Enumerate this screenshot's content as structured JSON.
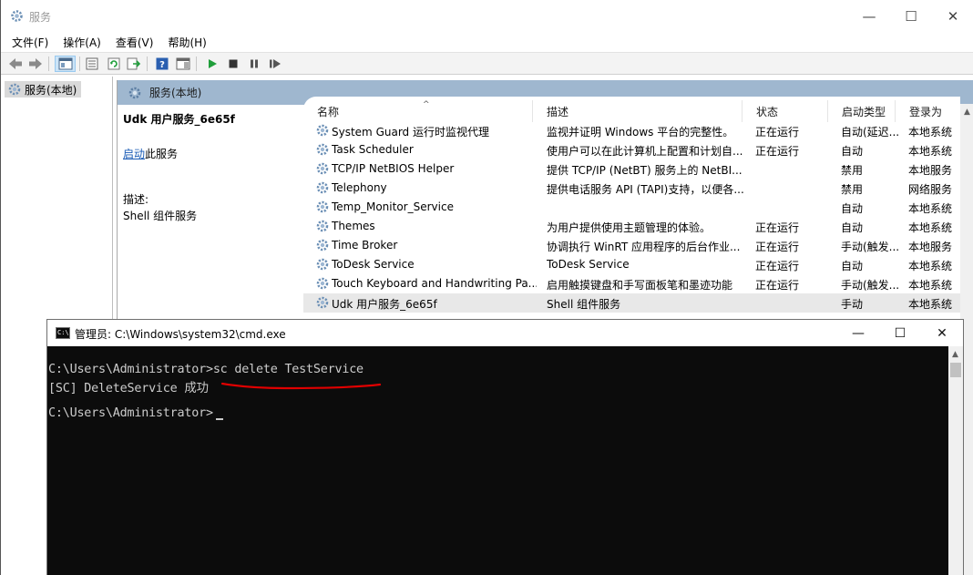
{
  "services_window": {
    "title": "服务",
    "caption": {
      "minimize": "—",
      "maximize": "☐",
      "close": "✕"
    },
    "menu": [
      "文件(F)",
      "操作(A)",
      "查看(V)",
      "帮助(H)"
    ],
    "tree_item": "服务(本地)",
    "panel_header": "服务(本地)",
    "detail": {
      "name": "Udk 用户服务_6e65f",
      "start_link": "启动",
      "start_suffix": "此服务",
      "desc_label": "描述:",
      "desc": "Shell 组件服务"
    },
    "columns": {
      "name": "名称",
      "desc": "描述",
      "status": "状态",
      "type": "启动类型",
      "logon": "登录为"
    },
    "rows": [
      {
        "name": "System Guard 运行时监视代理",
        "desc": "监视并证明 Windows 平台的完整性。",
        "status": "正在运行",
        "type": "自动(延迟...",
        "logon": "本地系统"
      },
      {
        "name": "Task Scheduler",
        "desc": "使用户可以在此计算机上配置和计划自...",
        "status": "正在运行",
        "type": "自动",
        "logon": "本地系统"
      },
      {
        "name": "TCP/IP NetBIOS Helper",
        "desc": "提供 TCP/IP (NetBT) 服务上的 NetBI...",
        "status": "",
        "type": "禁用",
        "logon": "本地服务"
      },
      {
        "name": "Telephony",
        "desc": "提供电话服务 API (TAPI)支持，以便各...",
        "status": "",
        "type": "禁用",
        "logon": "网络服务"
      },
      {
        "name": "Temp_Monitor_Service",
        "desc": "",
        "status": "",
        "type": "自动",
        "logon": "本地系统"
      },
      {
        "name": "Themes",
        "desc": "为用户提供使用主题管理的体验。",
        "status": "正在运行",
        "type": "自动",
        "logon": "本地系统"
      },
      {
        "name": "Time Broker",
        "desc": "协调执行 WinRT 应用程序的后台作业...",
        "status": "正在运行",
        "type": "手动(触发...",
        "logon": "本地服务"
      },
      {
        "name": "ToDesk Service",
        "desc": "ToDesk Service",
        "status": "正在运行",
        "type": "自动",
        "logon": "本地系统"
      },
      {
        "name": "Touch Keyboard and Handwriting Pa...",
        "desc": "启用触摸键盘和手写面板笔和墨迹功能",
        "status": "正在运行",
        "type": "手动(触发...",
        "logon": "本地系统"
      },
      {
        "name": "Udk 用户服务_6e65f",
        "desc": "Shell 组件服务",
        "status": "",
        "type": "手动",
        "logon": "本地系统"
      }
    ],
    "selected_row": 9
  },
  "cmd_window": {
    "icon_text": "C:\\",
    "title": "管理员: C:\\Windows\\system32\\cmd.exe",
    "caption": {
      "minimize": "—",
      "maximize": "☐",
      "close": "✕"
    },
    "lines": [
      "C:\\Users\\Administrator>sc delete TestService",
      "[SC] DeleteService 成功",
      "",
      "C:\\Users\\Administrator>"
    ]
  },
  "colors": {
    "panel_header": "#9fb7cf",
    "link": "#1a5bb5",
    "console_bg": "#0c0c0c",
    "console_text": "#cccccc",
    "annotation_red": "#e00000",
    "play_green": "#1f9e3a"
  }
}
